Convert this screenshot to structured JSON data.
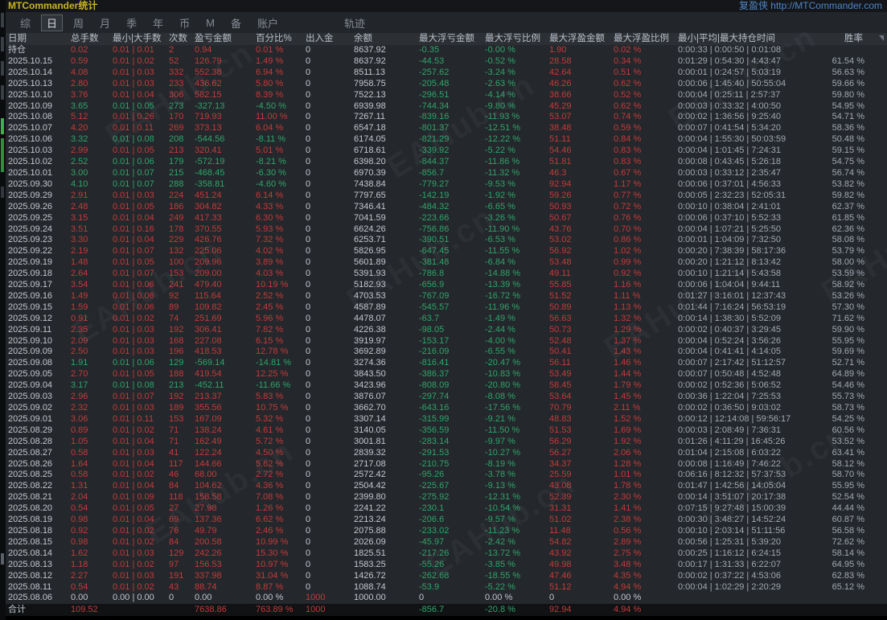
{
  "titlebar": {
    "title": "MTCommander统计",
    "link": "复盈侠 http://MTCommander.com"
  },
  "menu": {
    "items": [
      {
        "label": "综",
        "active": false,
        "gap": false
      },
      {
        "label": "日",
        "active": true,
        "gap": false
      },
      {
        "label": "周",
        "active": false,
        "gap": false
      },
      {
        "label": "月",
        "active": false,
        "gap": false
      },
      {
        "label": "季",
        "active": false,
        "gap": false
      },
      {
        "label": "年",
        "active": false,
        "gap": false
      },
      {
        "label": "币",
        "active": false,
        "gap": false
      },
      {
        "label": "M",
        "active": false,
        "gap": false
      },
      {
        "label": "备",
        "active": false,
        "gap": false
      },
      {
        "label": "账户",
        "active": false,
        "gap": false
      },
      {
        "label": "轨迹",
        "active": false,
        "gap": true
      }
    ]
  },
  "watermark": "EAHub.cn",
  "colors": {
    "positive_red": "#c43b3b",
    "negative_green": "#2fa56b",
    "title_yellow": "#c9b422",
    "link_blue": "#4f86c4"
  },
  "table": {
    "columns": [
      "日期",
      "总手数",
      "最小|大手数",
      "次数",
      "盈亏金额",
      "百分比%",
      "出入金",
      "余额",
      "最大浮亏金额",
      "最大浮亏比例",
      "最大浮盈金额",
      "最大浮盈比例",
      "最小|平均|最大持仓时间",
      "胜率"
    ],
    "rows": [
      {
        "c": [
          "持仓",
          "0.02",
          "0.01 | 0.01",
          "2",
          "0.94",
          "0.01 %",
          "0",
          "8637.92",
          "-0.35",
          "-0.00 %",
          "1.90",
          "0.02 %",
          "0:00:33 | 0:00:50 | 0:01:08",
          ""
        ],
        "t": "red"
      },
      {
        "c": [
          "2025.10.15",
          "0.59",
          "0.01 | 0.02",
          "52",
          "126.79",
          "1.49 %",
          "0",
          "8637.92",
          "-44.53",
          "-0.52 %",
          "28.58",
          "0.34 %",
          "0:01:29 | 0:54:30 | 4:43:47",
          "61.54 %"
        ],
        "t": "red"
      },
      {
        "c": [
          "2025.10.14",
          "4.08",
          "0.01 | 0.03",
          "332",
          "552.38",
          "6.94 %",
          "0",
          "8511.13",
          "-257.62",
          "-3.24 %",
          "42.64",
          "0.51 %",
          "0:00:01 | 0:24:57 | 5:03:19",
          "56.63 %"
        ],
        "t": "red"
      },
      {
        "c": [
          "2025.10.13",
          "2.80",
          "0.01 | 0.03",
          "233",
          "436.62",
          "5.80 %",
          "0",
          "7958.75",
          "-205.48",
          "-2.63 %",
          "46.26",
          "0.62 %",
          "0:00:06 | 1:45:40 | 50:55:04",
          "59.66 %"
        ],
        "t": "red"
      },
      {
        "c": [
          "2025.10.10",
          "3.76",
          "0.01 | 0.04",
          "306",
          "582.15",
          "8.39 %",
          "0",
          "7522.13",
          "-296.51",
          "-4.14 %",
          "38.66",
          "0.52 %",
          "0:00:04 | 0:25:11 | 2:57:37",
          "59.80 %"
        ],
        "t": "red"
      },
      {
        "c": [
          "2025.10.09",
          "3.65",
          "0.01 | 0.05",
          "273",
          "-327.13",
          "-4.50 %",
          "0",
          "6939.98",
          "-744.34",
          "-9.80 %",
          "45.29",
          "0.62 %",
          "0:00:03 | 0:33:32 | 4:00:50",
          "54.95 %"
        ],
        "t": "green"
      },
      {
        "c": [
          "2025.10.08",
          "5.12",
          "0.01 | 0.26",
          "170",
          "719.93",
          "11.00 %",
          "0",
          "7267.11",
          "-839.16",
          "-11.93 %",
          "53.07",
          "0.74 %",
          "0:00:02 | 1:36:56 | 9:25:40",
          "54.71 %"
        ],
        "t": "red"
      },
      {
        "c": [
          "2025.10.07",
          "4.20",
          "0.01 | 0.11",
          "269",
          "373.13",
          "6.04 %",
          "0",
          "6547.18",
          "-801.37",
          "-12.51 %",
          "38.48",
          "0.59 %",
          "0:00:07 | 0:41:54 | 5:34:20",
          "58.36 %"
        ],
        "t": "red"
      },
      {
        "c": [
          "2025.10.06",
          "3.32",
          "0.01 | 0.08",
          "208",
          "-544.56",
          "-8.11 %",
          "0",
          "6174.05",
          "-821.29",
          "-12.22 %",
          "51.11",
          "0.84 %",
          "0:00:04 | 1:55:30 | 50:03:59",
          "50.48 %"
        ],
        "t": "green"
      },
      {
        "c": [
          "2025.10.03",
          "2.99",
          "0.01 | 0.05",
          "213",
          "320.41",
          "5.01 %",
          "0",
          "6718.61",
          "-339.92",
          "-5.22 %",
          "54.46",
          "0.83 %",
          "0:00:04 | 1:01:45 | 7:24:31",
          "59.15 %"
        ],
        "t": "red"
      },
      {
        "c": [
          "2025.10.02",
          "2.52",
          "0.01 | 0.06",
          "179",
          "-572.19",
          "-8.21 %",
          "0",
          "6398.20",
          "-844.37",
          "-11.86 %",
          "51.81",
          "0.83 %",
          "0:00:08 | 0:43:45 | 5:26:18",
          "54.75 %"
        ],
        "t": "green"
      },
      {
        "c": [
          "2025.10.01",
          "3.00",
          "0.01 | 0.07",
          "215",
          "-468.45",
          "-6.30 %",
          "0",
          "6970.39",
          "-856.7",
          "-11.32 %",
          "46.3",
          "0.67 %",
          "0:00:03 | 0:33:12 | 2:35:47",
          "56.74 %"
        ],
        "t": "green"
      },
      {
        "c": [
          "2025.09.30",
          "4.10",
          "0.01 | 0.07",
          "288",
          "-358.81",
          "-4.60 %",
          "0",
          "7438.84",
          "-779.27",
          "-9.53 %",
          "92.94",
          "1.17 %",
          "0:00:06 | 0:37:01 | 4:56:33",
          "53.82 %"
        ],
        "t": "green"
      },
      {
        "c": [
          "2025.09.29",
          "2.91",
          "0.01 | 0.03",
          "224",
          "451.24",
          "6.14 %",
          "0",
          "7797.65",
          "-142.19",
          "-1.92 %",
          "59.26",
          "0.77 %",
          "0:00:05 | 2:32:23 | 52:05:31",
          "59.82 %"
        ],
        "t": "red"
      },
      {
        "c": [
          "2025.09.26",
          "2.48",
          "0.01 | 0.05",
          "186",
          "304.82",
          "4.33 %",
          "0",
          "7346.41",
          "-484.32",
          "-6.65 %",
          "50.93",
          "0.72 %",
          "0:00:10 | 0:38:04 | 2:41:01",
          "62.37 %"
        ],
        "t": "red"
      },
      {
        "c": [
          "2025.09.25",
          "3.15",
          "0.01 | 0.04",
          "249",
          "417.33",
          "6.30 %",
          "0",
          "7041.59",
          "-223.66",
          "-3.26 %",
          "50.67",
          "0.76 %",
          "0:00:06 | 0:37:10 | 5:52:33",
          "61.85 %"
        ],
        "t": "red"
      },
      {
        "c": [
          "2025.09.24",
          "3.51",
          "0.01 | 0.16",
          "178",
          "370.55",
          "5.93 %",
          "0",
          "6624.26",
          "-756.86",
          "-11.90 %",
          "43.76",
          "0.70 %",
          "0:00:04 | 1:07:21 | 5:25:50",
          "62.36 %"
        ],
        "t": "red"
      },
      {
        "c": [
          "2025.09.23",
          "3.30",
          "0.01 | 0.04",
          "229",
          "426.76",
          "7.32 %",
          "0",
          "6253.71",
          "-390.51",
          "-6.53 %",
          "53.02",
          "0.86 %",
          "0:00:01 | 1:04:09 | 7:32:50",
          "58.08 %"
        ],
        "t": "red"
      },
      {
        "c": [
          "2025.09.22",
          "2.19",
          "0.01 | 0.07",
          "132",
          "225.06",
          "4.02 %",
          "0",
          "5826.95",
          "-647.45",
          "-11.55 %",
          "56.92",
          "1.02 %",
          "0:00:20 | 7:38:39 | 58:17:36",
          "53.79 %"
        ],
        "t": "red"
      },
      {
        "c": [
          "2025.09.19",
          "1.48",
          "0.01 | 0.05",
          "100",
          "209.96",
          "3.89 %",
          "0",
          "5601.89",
          "-381.48",
          "-6.84 %",
          "53.48",
          "0.99 %",
          "0:00:20 | 1:21:12 | 8:13:42",
          "58.00 %"
        ],
        "t": "red"
      },
      {
        "c": [
          "2025.09.18",
          "2.64",
          "0.01 | 0.07",
          "153",
          "209.00",
          "4.03 %",
          "0",
          "5391.93",
          "-786.8",
          "-14.88 %",
          "49.11",
          "0.92 %",
          "0:00:10 | 1:21:14 | 5:43:58",
          "53.59 %"
        ],
        "t": "red"
      },
      {
        "c": [
          "2025.09.17",
          "3.54",
          "0.01 | 0.06",
          "241",
          "479.40",
          "10.19 %",
          "0",
          "5182.93",
          "-656.9",
          "-13.39 %",
          "55.85",
          "1.16 %",
          "0:00:06 | 1:04:04 | 9:44:11",
          "58.92 %"
        ],
        "t": "red"
      },
      {
        "c": [
          "2025.09.16",
          "1.49",
          "0.01 | 0.06",
          "92",
          "115.64",
          "2.52 %",
          "0",
          "4703.53",
          "-767.09",
          "-16.72 %",
          "51.52",
          "1.11 %",
          "0:01:27 | 3:16:01 | 12:37:43",
          "53.26 %"
        ],
        "t": "red"
      },
      {
        "c": [
          "2025.09.15",
          "1.59",
          "0.01 | 0.06",
          "89",
          "109.82",
          "2.45 %",
          "0",
          "4587.89",
          "-545.57",
          "-11.96 %",
          "50.89",
          "1.13 %",
          "0:01:44 | 7:16:24 | 56:53:19",
          "57.30 %"
        ],
        "t": "red"
      },
      {
        "c": [
          "2025.09.12",
          "0.91",
          "0.01 | 0.02",
          "74",
          "251.69",
          "5.96 %",
          "0",
          "4478.07",
          "-63.7",
          "-1.49 %",
          "56.63",
          "1.32 %",
          "0:00:14 | 1:38:30 | 5:52:09",
          "71.62 %"
        ],
        "t": "red"
      },
      {
        "c": [
          "2025.09.11",
          "2.35",
          "0.01 | 0.03",
          "192",
          "306.41",
          "7.82 %",
          "0",
          "4226.38",
          "-98.05",
          "-2.44 %",
          "50.73",
          "1.29 %",
          "0:00:02 | 0:40:37 | 3:29:45",
          "59.90 %"
        ],
        "t": "red"
      },
      {
        "c": [
          "2025.09.10",
          "2.09",
          "0.01 | 0.03",
          "168",
          "227.08",
          "6.15 %",
          "0",
          "3919.97",
          "-153.17",
          "-4.00 %",
          "52.48",
          "1.37 %",
          "0:00:04 | 0:52:24 | 3:56:26",
          "55.95 %"
        ],
        "t": "red"
      },
      {
        "c": [
          "2025.09.09",
          "2.50",
          "0.01 | 0.03",
          "196",
          "418.53",
          "12.78 %",
          "0",
          "3692.89",
          "-216.09",
          "-6.55 %",
          "50.41",
          "1.43 %",
          "0:00:04 | 0:41:41 | 4:14:05",
          "59.69 %"
        ],
        "t": "red"
      },
      {
        "c": [
          "2025.09.08",
          "1.91",
          "0.01 | 0.06",
          "129",
          "-569.14",
          "-14.81 %",
          "0",
          "3274.36",
          "-816.41",
          "-20.47 %",
          "56.11",
          "1.46 %",
          "0:00:07 | 2:17:42 | 51:12:57",
          "52.71 %"
        ],
        "t": "green"
      },
      {
        "c": [
          "2025.09.05",
          "2.70",
          "0.01 | 0.05",
          "188",
          "419.54",
          "12.25 %",
          "0",
          "3843.50",
          "-386.37",
          "-10.83 %",
          "53.49",
          "1.44 %",
          "0:00:07 | 0:50:48 | 4:52:48",
          "64.89 %"
        ],
        "t": "red"
      },
      {
        "c": [
          "2025.09.04",
          "3.17",
          "0.01 | 0.08",
          "213",
          "-452.11",
          "-11.66 %",
          "0",
          "3423.96",
          "-808.09",
          "-20.80 %",
          "58.45",
          "1.79 %",
          "0:00:02 | 0:52:36 | 5:06:52",
          "54.46 %"
        ],
        "t": "green"
      },
      {
        "c": [
          "2025.09.03",
          "2.96",
          "0.01 | 0.07",
          "192",
          "213.37",
          "5.83 %",
          "0",
          "3876.07",
          "-297.74",
          "-8.08 %",
          "53.64",
          "1.45 %",
          "0:00:36 | 1:22:04 | 7:25:53",
          "55.73 %"
        ],
        "t": "red"
      },
      {
        "c": [
          "2025.09.02",
          "2.32",
          "0.01 | 0.03",
          "189",
          "355.56",
          "10.75 %",
          "0",
          "3662.70",
          "-643.16",
          "-17.56 %",
          "70.79",
          "2.11 %",
          "0:00:02 | 0:36:50 | 9:03:02",
          "58.73 %"
        ],
        "t": "red"
      },
      {
        "c": [
          "2025.09.01",
          "3.06",
          "0.01 | 0.11",
          "153",
          "167.09",
          "5.32 %",
          "0",
          "3307.14",
          "-315.99",
          "-9.21 %",
          "48.83",
          "1.52 %",
          "0:00:12 | 12:14:08 | 59:56:17",
          "54.25 %"
        ],
        "t": "red"
      },
      {
        "c": [
          "2025.08.29",
          "0.89",
          "0.01 | 0.02",
          "71",
          "138.24",
          "4.61 %",
          "0",
          "3140.05",
          "-356.59",
          "-11.50 %",
          "51.53",
          "1.69 %",
          "0:00:03 | 2:08:49 | 7:36:31",
          "60.56 %"
        ],
        "t": "red"
      },
      {
        "c": [
          "2025.08.28",
          "1.05",
          "0.01 | 0.04",
          "71",
          "162.49",
          "5.72 %",
          "0",
          "3001.81",
          "-283.14",
          "-9.97 %",
          "56.29",
          "1.92 %",
          "0:01:26 | 4:11:29 | 16:45:26",
          "53.52 %"
        ],
        "t": "red"
      },
      {
        "c": [
          "2025.08.27",
          "0.58",
          "0.01 | 0.03",
          "41",
          "122.24",
          "4.50 %",
          "0",
          "2839.32",
          "-291.53",
          "-10.27 %",
          "56.27",
          "2.06 %",
          "0:01:04 | 2:15:08 | 6:03:22",
          "63.41 %"
        ],
        "t": "red"
      },
      {
        "c": [
          "2025.08.26",
          "1.64",
          "0.01 | 0.04",
          "117",
          "144.66",
          "5.62 %",
          "0",
          "2717.08",
          "-210.75",
          "-8.19 %",
          "34.37",
          "1.28 %",
          "0:00:08 | 1:16:49 | 7:46:22",
          "58.12 %"
        ],
        "t": "red"
      },
      {
        "c": [
          "2025.08.25",
          "0.58",
          "0.01 | 0.02",
          "46",
          "68.00",
          "2.72 %",
          "0",
          "2572.42",
          "-95.26",
          "-3.78 %",
          "25.59",
          "1.01 %",
          "0:06:16 | 8:12:32 | 57:37:53",
          "58.70 %"
        ],
        "t": "red"
      },
      {
        "c": [
          "2025.08.22",
          "1.31",
          "0.01 | 0.04",
          "84",
          "104.62",
          "4.36 %",
          "0",
          "2504.42",
          "-225.67",
          "-9.13 %",
          "43.08",
          "1.78 %",
          "0:01:47 | 1:42:56 | 14:05:04",
          "55.95 %"
        ],
        "t": "red"
      },
      {
        "c": [
          "2025.08.21",
          "2.04",
          "0.01 | 0.09",
          "118",
          "158.58",
          "7.08 %",
          "0",
          "2399.80",
          "-275.92",
          "-12.31 %",
          "52.39",
          "2.30 %",
          "0:00:14 | 3:51:07 | 20:17:38",
          "52.54 %"
        ],
        "t": "red"
      },
      {
        "c": [
          "2025.08.20",
          "0.54",
          "0.01 | 0.05",
          "27",
          "27.98",
          "1.26 %",
          "0",
          "2241.22",
          "-230.1",
          "-10.54 %",
          "31.31",
          "1.41 %",
          "0:07:15 | 9:27:48 | 15:00:39",
          "44.44 %"
        ],
        "t": "red"
      },
      {
        "c": [
          "2025.08.19",
          "0.98",
          "0.01 | 0.04",
          "69",
          "137.36",
          "6.62 %",
          "0",
          "2213.24",
          "-206.6",
          "-9.57 %",
          "51.02",
          "2.38 %",
          "0:00:30 | 3:48:27 | 14:52:24",
          "60.87 %"
        ],
        "t": "red"
      },
      {
        "c": [
          "2025.08.18",
          "0.92",
          "0.01 | 0.02",
          "76",
          "49.79",
          "2.46 %",
          "0",
          "2075.88",
          "-233.02",
          "-11.23 %",
          "11.48",
          "0.56 %",
          "0:00:10 | 2:03:14 | 51:11:56",
          "56.58 %"
        ],
        "t": "red"
      },
      {
        "c": [
          "2025.08.15",
          "0.98",
          "0.01 | 0.02",
          "84",
          "200.58",
          "10.99 %",
          "0",
          "2026.09",
          "-45.97",
          "-2.42 %",
          "54.82",
          "2.89 %",
          "0:00:56 | 1:25:31 | 5:39:20",
          "72.62 %"
        ],
        "t": "red"
      },
      {
        "c": [
          "2025.08.14",
          "1.62",
          "0.01 | 0.03",
          "129",
          "242.26",
          "15.30 %",
          "0",
          "1825.51",
          "-217.26",
          "-13.72 %",
          "43.92",
          "2.75 %",
          "0:00:25 | 1:16:12 | 6:24:15",
          "58.14 %"
        ],
        "t": "red"
      },
      {
        "c": [
          "2025.08.13",
          "1.18",
          "0.01 | 0.02",
          "97",
          "156.53",
          "10.97 %",
          "0",
          "1583.25",
          "-55.26",
          "-3.85 %",
          "49.98",
          "3.48 %",
          "0:00:17 | 1:31:33 | 6:22:07",
          "64.95 %"
        ],
        "t": "red"
      },
      {
        "c": [
          "2025.08.12",
          "2.27",
          "0.01 | 0.03",
          "191",
          "337.98",
          "31.04 %",
          "0",
          "1426.72",
          "-262.68",
          "-18.55 %",
          "47.46",
          "4.35 %",
          "0:00:02 | 0:37:22 | 4:53:06",
          "62.83 %"
        ],
        "t": "red"
      },
      {
        "c": [
          "2025.08.11",
          "0.54",
          "0.01 | 0.02",
          "43",
          "88.74",
          "8.87 %",
          "0",
          "1088.74",
          "-53.9",
          "-5.22 %",
          "51.12",
          "4.94 %",
          "0:00:04 | 1:02:29 | 2:20:29",
          "65.12 %"
        ],
        "t": "red"
      },
      {
        "c": [
          "2025.08.06",
          "0.00",
          "0.00 | 0.00",
          "0",
          "0.00",
          "0.00 %",
          "1000",
          "1000.00",
          "0",
          "0.00 %",
          "0",
          "0.00 %",
          "",
          ""
        ],
        "t": "neutral"
      }
    ],
    "total": {
      "c": [
        "合计",
        "109.52",
        "",
        "",
        "7638.86",
        "763.89 %",
        "1000",
        "",
        "-856.7",
        "-20.8 %",
        "92.94",
        "4.94 %",
        "",
        ""
      ],
      "t": "red"
    }
  }
}
